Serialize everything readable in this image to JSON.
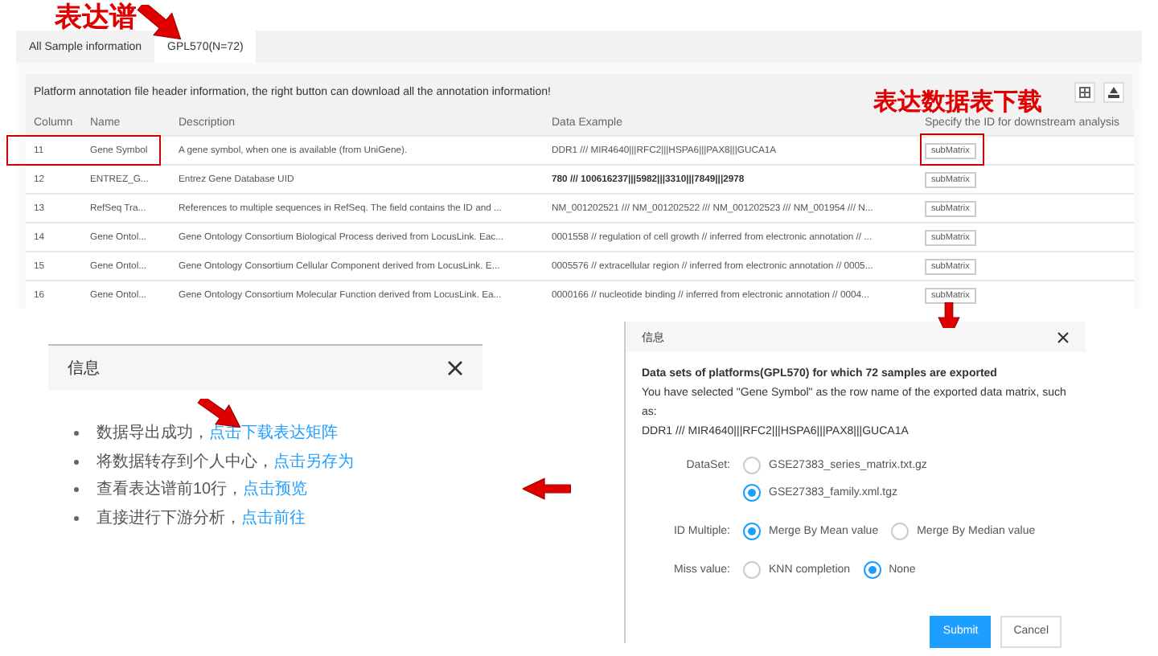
{
  "annotations": {
    "tab_note": "表达谱",
    "download_note": "表达数据表下载"
  },
  "tabs": [
    {
      "label": "All Sample information",
      "selected": false
    },
    {
      "label": "GPL570(N=72)",
      "selected": true
    }
  ],
  "panel": {
    "header_text": "Platform annotation file header information, the right button can download all the annotation information!"
  },
  "table": {
    "columns": [
      "Column",
      "Name",
      "Description",
      "Data Example",
      "Specify the ID for downstream analysis"
    ],
    "rows": [
      {
        "column": "11",
        "name": "Gene Symbol",
        "description": "A gene symbol, when one is available (from UniGene).",
        "data_example": "DDR1 /// MIR4640|||RFC2|||HSPA6|||PAX8|||GUCA1A",
        "action": "subMatrix",
        "marked": true
      },
      {
        "column": "12",
        "name": "ENTREZ_G...",
        "description": "Entrez Gene Database UID",
        "data_example": "780 /// 100616237|||5982|||3310|||7849|||2978",
        "action": "subMatrix",
        "marked": false
      },
      {
        "column": "13",
        "name": "RefSeq Tra...",
        "description": "References to multiple sequences in RefSeq. The field contains the ID and ...",
        "data_example": "NM_001202521 /// NM_001202522 /// NM_001202523 /// NM_001954 /// N...",
        "action": "subMatrix",
        "marked": false
      },
      {
        "column": "14",
        "name": "Gene Ontol...",
        "description": "Gene Ontology Consortium Biological Process derived from LocusLink. Eac...",
        "data_example": "0001558 // regulation of cell growth // inferred from electronic annotation // ...",
        "action": "subMatrix",
        "marked": false
      },
      {
        "column": "15",
        "name": "Gene Ontol...",
        "description": "Gene Ontology Consortium Cellular Component derived from LocusLink. E...",
        "data_example": "0005576 // extracellular region // inferred from electronic annotation // 0005...",
        "action": "subMatrix",
        "marked": false
      },
      {
        "column": "16",
        "name": "Gene Ontol...",
        "description": "Gene Ontology Consortium Molecular Function derived from LocusLink. Ea...",
        "data_example": "0000166 // nucleotide binding // inferred from electronic annotation // 0004...",
        "action": "subMatrix",
        "marked": false
      }
    ]
  },
  "info_dialog": {
    "title": "信息",
    "items": [
      {
        "text": "数据导出成功，",
        "link": "点击下载表达矩阵"
      },
      {
        "text": "将数据转存到个人中心，",
        "link": "点击另存为"
      },
      {
        "text": "查看表达谱前10行，",
        "link": "点击预览"
      },
      {
        "text": "直接进行下游分析，",
        "link": "点击前往"
      }
    ]
  },
  "export_dialog": {
    "title": "信息",
    "heading": "Data sets of platforms(GPL570) for which 72 samples are exported",
    "note": "You have selected \"Gene Symbol\" as the row name of the exported data matrix, such as:",
    "example": "DDR1 /// MIR4640|||RFC2|||HSPA6|||PAX8|||GUCA1A",
    "fields": [
      {
        "label": "DataSet:",
        "kind": "stacked",
        "options": [
          {
            "label": "GSE27383_series_matrix.txt.gz",
            "selected": false
          },
          {
            "label": "GSE27383_family.xml.tgz",
            "selected": true
          }
        ]
      },
      {
        "label": "ID Multiple:",
        "kind": "inline",
        "options": [
          {
            "label": "Merge By Mean value",
            "selected": true
          },
          {
            "label": "Merge By Median value",
            "selected": false
          }
        ]
      },
      {
        "label": "Miss value:",
        "kind": "inline",
        "options": [
          {
            "label": "KNN completion",
            "selected": false
          },
          {
            "label": "None",
            "selected": true
          }
        ]
      }
    ],
    "buttons": [
      {
        "label": "Submit",
        "kind": "primary"
      },
      {
        "label": "Cancel",
        "kind": "default"
      }
    ]
  }
}
